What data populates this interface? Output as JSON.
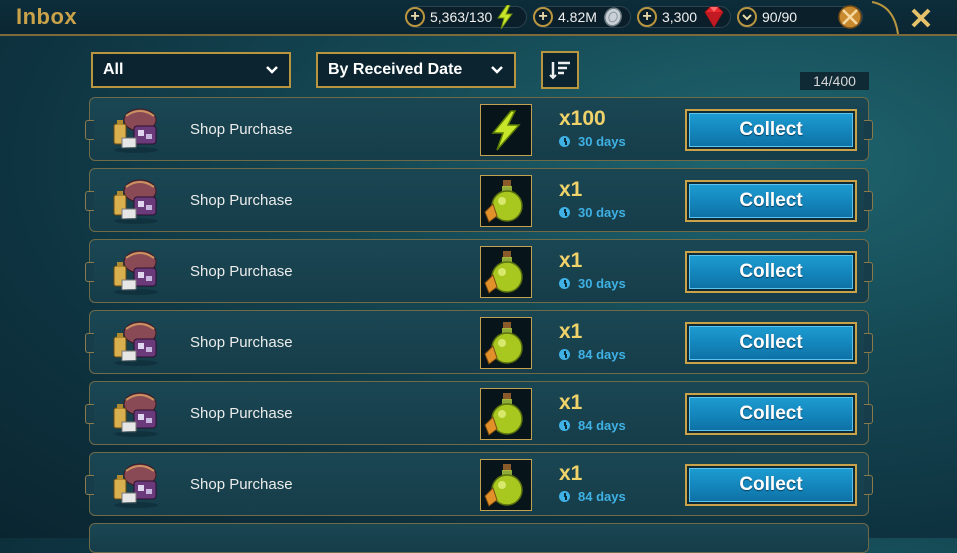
{
  "header": {
    "title": "Inbox",
    "resources": [
      {
        "name": "energy",
        "value": "5,363/130",
        "icon": "lightning-icon"
      },
      {
        "name": "silver",
        "value": "4.82M",
        "icon": "silver-coin-icon"
      },
      {
        "name": "gems",
        "value": "3,300",
        "icon": "ruby-icon"
      },
      {
        "name": "arena-tokens",
        "value": "90/90",
        "icon": "crossed-swords-icon"
      }
    ],
    "close_icon": "close-icon"
  },
  "filters": {
    "type_filter": "All",
    "sort_by": "By Received Date",
    "sort_icon": "sort-order-icon"
  },
  "inbox_count": "14/400",
  "messages": [
    {
      "label": "Shop Purchase",
      "item": "energy",
      "quantity": "x100",
      "expires": "30 days",
      "action": "Collect"
    },
    {
      "label": "Shop Purchase",
      "item": "potion",
      "quantity": "x1",
      "expires": "30 days",
      "action": "Collect"
    },
    {
      "label": "Shop Purchase",
      "item": "potion",
      "quantity": "x1",
      "expires": "30 days",
      "action": "Collect"
    },
    {
      "label": "Shop Purchase",
      "item": "potion",
      "quantity": "x1",
      "expires": "84 days",
      "action": "Collect"
    },
    {
      "label": "Shop Purchase",
      "item": "potion",
      "quantity": "x1",
      "expires": "84 days",
      "action": "Collect"
    },
    {
      "label": "Shop Purchase",
      "item": "potion",
      "quantity": "x1",
      "expires": "84 days",
      "action": "Collect"
    }
  ],
  "colors": {
    "accent_gold": "#c9a24a",
    "button_blue": "#1487bd",
    "timer_blue": "#3fb1e5",
    "quantity_yellow": "#f0d26a"
  }
}
